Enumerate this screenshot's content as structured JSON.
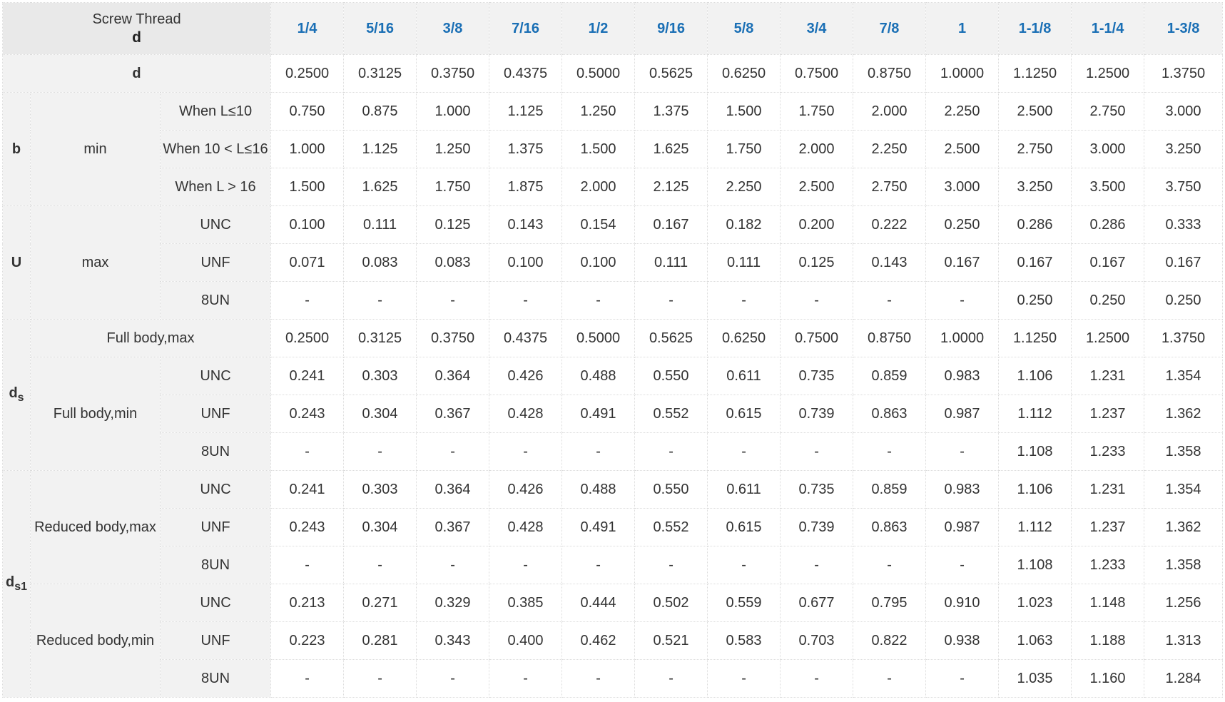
{
  "header": {
    "title": "Screw Thread",
    "symbol": "d",
    "sizes": [
      "1/4",
      "5/16",
      "3/8",
      "7/16",
      "1/2",
      "9/16",
      "5/8",
      "3/4",
      "7/8",
      "1",
      "1-1/8",
      "1-1/4",
      "1-3/8"
    ]
  },
  "d_row": {
    "label": "d",
    "values": [
      "0.2500",
      "0.3125",
      "0.3750",
      "0.4375",
      "0.5000",
      "0.5625",
      "0.6250",
      "0.7500",
      "0.8750",
      "1.0000",
      "1.1250",
      "1.2500",
      "1.3750"
    ]
  },
  "b": {
    "symbol": "b",
    "group": "min",
    "rows": [
      {
        "label": "When L≤10",
        "values": [
          "0.750",
          "0.875",
          "1.000",
          "1.125",
          "1.250",
          "1.375",
          "1.500",
          "1.750",
          "2.000",
          "2.250",
          "2.500",
          "2.750",
          "3.000"
        ]
      },
      {
        "label": "When 10 < L≤16",
        "values": [
          "1.000",
          "1.125",
          "1.250",
          "1.375",
          "1.500",
          "1.625",
          "1.750",
          "2.000",
          "2.250",
          "2.500",
          "2.750",
          "3.000",
          "3.250"
        ]
      },
      {
        "label": "When L > 16",
        "values": [
          "1.500",
          "1.625",
          "1.750",
          "1.875",
          "2.000",
          "2.125",
          "2.250",
          "2.500",
          "2.750",
          "3.000",
          "3.250",
          "3.500",
          "3.750"
        ]
      }
    ]
  },
  "u": {
    "symbol": "U",
    "group": "max",
    "rows": [
      {
        "label": "UNC",
        "values": [
          "0.100",
          "0.111",
          "0.125",
          "0.143",
          "0.154",
          "0.167",
          "0.182",
          "0.200",
          "0.222",
          "0.250",
          "0.286",
          "0.286",
          "0.333"
        ]
      },
      {
        "label": "UNF",
        "values": [
          "0.071",
          "0.083",
          "0.083",
          "0.100",
          "0.100",
          "0.111",
          "0.111",
          "0.125",
          "0.143",
          "0.167",
          "0.167",
          "0.167",
          "0.167"
        ]
      },
      {
        "label": "8UN",
        "values": [
          "-",
          "-",
          "-",
          "-",
          "-",
          "-",
          "-",
          "-",
          "-",
          "-",
          "0.250",
          "0.250",
          "0.250"
        ]
      }
    ]
  },
  "ds": {
    "symbol": "d",
    "subscript": "s",
    "full_max": {
      "label": "Full body,max",
      "values": [
        "0.2500",
        "0.3125",
        "0.3750",
        "0.4375",
        "0.5000",
        "0.5625",
        "0.6250",
        "0.7500",
        "0.8750",
        "1.0000",
        "1.1250",
        "1.2500",
        "1.3750"
      ]
    },
    "group": "Full body,min",
    "rows": [
      {
        "label": "UNC",
        "values": [
          "0.241",
          "0.303",
          "0.364",
          "0.426",
          "0.488",
          "0.550",
          "0.611",
          "0.735",
          "0.859",
          "0.983",
          "1.106",
          "1.231",
          "1.354"
        ]
      },
      {
        "label": "UNF",
        "values": [
          "0.243",
          "0.304",
          "0.367",
          "0.428",
          "0.491",
          "0.552",
          "0.615",
          "0.739",
          "0.863",
          "0.987",
          "1.112",
          "1.237",
          "1.362"
        ]
      },
      {
        "label": "8UN",
        "values": [
          "-",
          "-",
          "-",
          "-",
          "-",
          "-",
          "-",
          "-",
          "-",
          "-",
          "1.108",
          "1.233",
          "1.358"
        ]
      }
    ]
  },
  "ds1": {
    "symbol": "d",
    "subscript": "s1",
    "groups": [
      {
        "label": "Reduced body,max",
        "rows": [
          {
            "label": "UNC",
            "values": [
              "0.241",
              "0.303",
              "0.364",
              "0.426",
              "0.488",
              "0.550",
              "0.611",
              "0.735",
              "0.859",
              "0.983",
              "1.106",
              "1.231",
              "1.354"
            ]
          },
          {
            "label": "UNF",
            "values": [
              "0.243",
              "0.304",
              "0.367",
              "0.428",
              "0.491",
              "0.552",
              "0.615",
              "0.739",
              "0.863",
              "0.987",
              "1.112",
              "1.237",
              "1.362"
            ]
          },
          {
            "label": "8UN",
            "values": [
              "-",
              "-",
              "-",
              "-",
              "-",
              "-",
              "-",
              "-",
              "-",
              "-",
              "1.108",
              "1.233",
              "1.358"
            ]
          }
        ]
      },
      {
        "label": "Reduced body,min",
        "rows": [
          {
            "label": "UNC",
            "values": [
              "0.213",
              "0.271",
              "0.329",
              "0.385",
              "0.444",
              "0.502",
              "0.559",
              "0.677",
              "0.795",
              "0.910",
              "1.023",
              "1.148",
              "1.256"
            ]
          },
          {
            "label": "UNF",
            "values": [
              "0.223",
              "0.281",
              "0.343",
              "0.400",
              "0.462",
              "0.521",
              "0.583",
              "0.703",
              "0.822",
              "0.938",
              "1.063",
              "1.188",
              "1.313"
            ]
          },
          {
            "label": "8UN",
            "values": [
              "-",
              "-",
              "-",
              "-",
              "-",
              "-",
              "-",
              "-",
              "-",
              "-",
              "1.035",
              "1.160",
              "1.284"
            ]
          }
        ]
      }
    ]
  }
}
